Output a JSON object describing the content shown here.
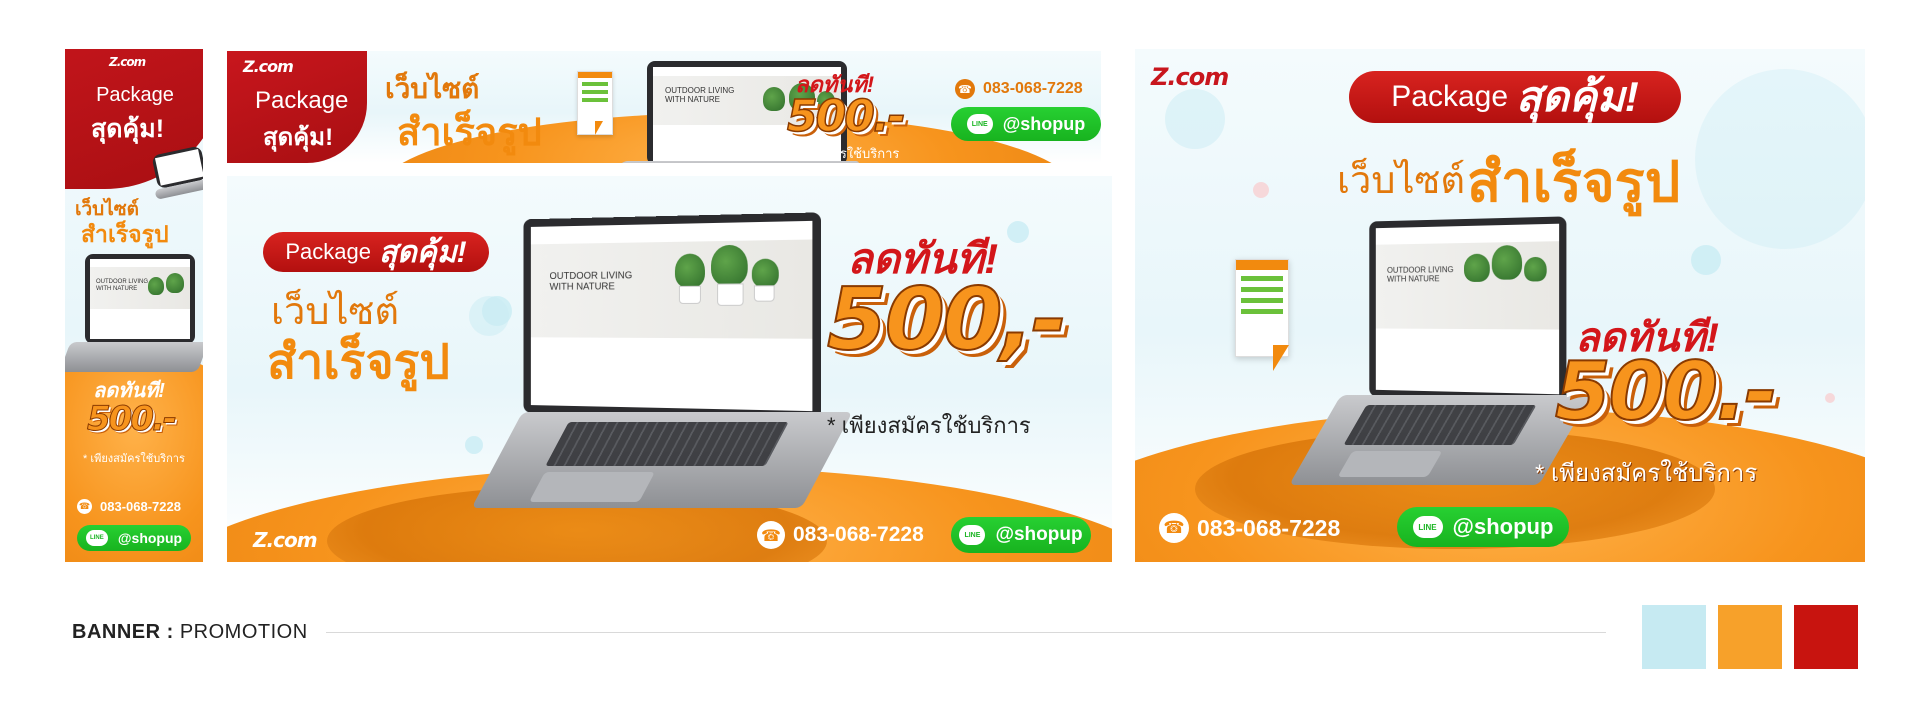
{
  "brand": {
    "logo": "Z.com"
  },
  "common": {
    "package": "Package",
    "sud_kum": "สุดคุ้ม!",
    "website_line1": "เว็บไซต์",
    "website_line2": "สำเร็จรูป",
    "discount": "ลดทันที!",
    "price": "500.-",
    "price_alt": "500,-",
    "note": "* เพียงสมัครใช้บริการ",
    "phone": "083-068-7228",
    "line_id": "@shopup",
    "line_icon_text": "LINE"
  },
  "site_preview": {
    "headline_1": "OUTDOOR LIVING",
    "headline_2": "WITH NATURE"
  },
  "footer": {
    "label_bold": "BANNER :",
    "label": "PROMOTION"
  },
  "palette": [
    "#c6eaf2",
    "#f7a12a",
    "#c8140f"
  ],
  "icons": {
    "phone": "phone-icon",
    "line": "line-icon"
  }
}
